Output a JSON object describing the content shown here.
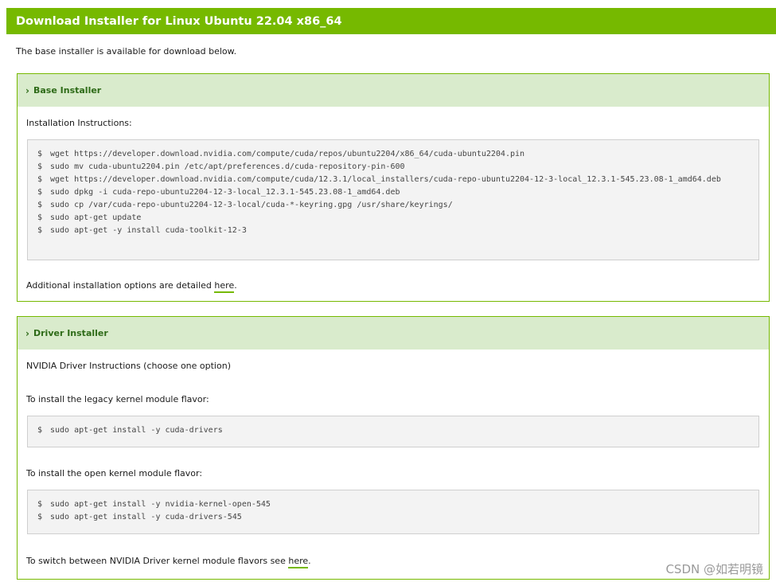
{
  "header": {
    "title": "Download Installer for Linux Ubuntu 22.04 x86_64"
  },
  "intro_text": "The base installer is available for download below.",
  "base_installer": {
    "title": "Base Installer",
    "instructions_label": "Installation Instructions:",
    "commands": [
      "wget https://developer.download.nvidia.com/compute/cuda/repos/ubuntu2204/x86_64/cuda-ubuntu2204.pin",
      "sudo mv cuda-ubuntu2204.pin /etc/apt/preferences.d/cuda-repository-pin-600",
      "wget https://developer.download.nvidia.com/compute/cuda/12.3.1/local_installers/cuda-repo-ubuntu2204-12-3-local_12.3.1-545.23.08-1_amd64.deb",
      "sudo dpkg -i cuda-repo-ubuntu2204-12-3-local_12.3.1-545.23.08-1_amd64.deb",
      "sudo cp /var/cuda-repo-ubuntu2204-12-3-local/cuda-*-keyring.gpg /usr/share/keyrings/",
      "sudo apt-get update",
      "sudo apt-get -y install cuda-toolkit-12-3"
    ],
    "additional_prefix": "Additional installation options are detailed ",
    "additional_link": "here",
    "additional_suffix": "."
  },
  "driver_installer": {
    "title": "Driver Installer",
    "instructions_label": "NVIDIA Driver Instructions (choose one option)",
    "legacy_label": "To install the legacy kernel module flavor:",
    "legacy_commands": [
      "sudo apt-get install -y cuda-drivers"
    ],
    "open_label": "To install the open kernel module flavor:",
    "open_commands": [
      "sudo apt-get install -y nvidia-kernel-open-545",
      "sudo apt-get install -y cuda-drivers-545"
    ],
    "switch_prefix": "To switch between NVIDIA Driver kernel module flavors see ",
    "switch_link": "here",
    "switch_suffix": "."
  },
  "prompt_symbol": "$",
  "watermark": "CSDN @如若明镜",
  "colors": {
    "accent": "#76b900",
    "panel_header": "#d9ebcc",
    "code_bg": "#f3f3f3"
  }
}
